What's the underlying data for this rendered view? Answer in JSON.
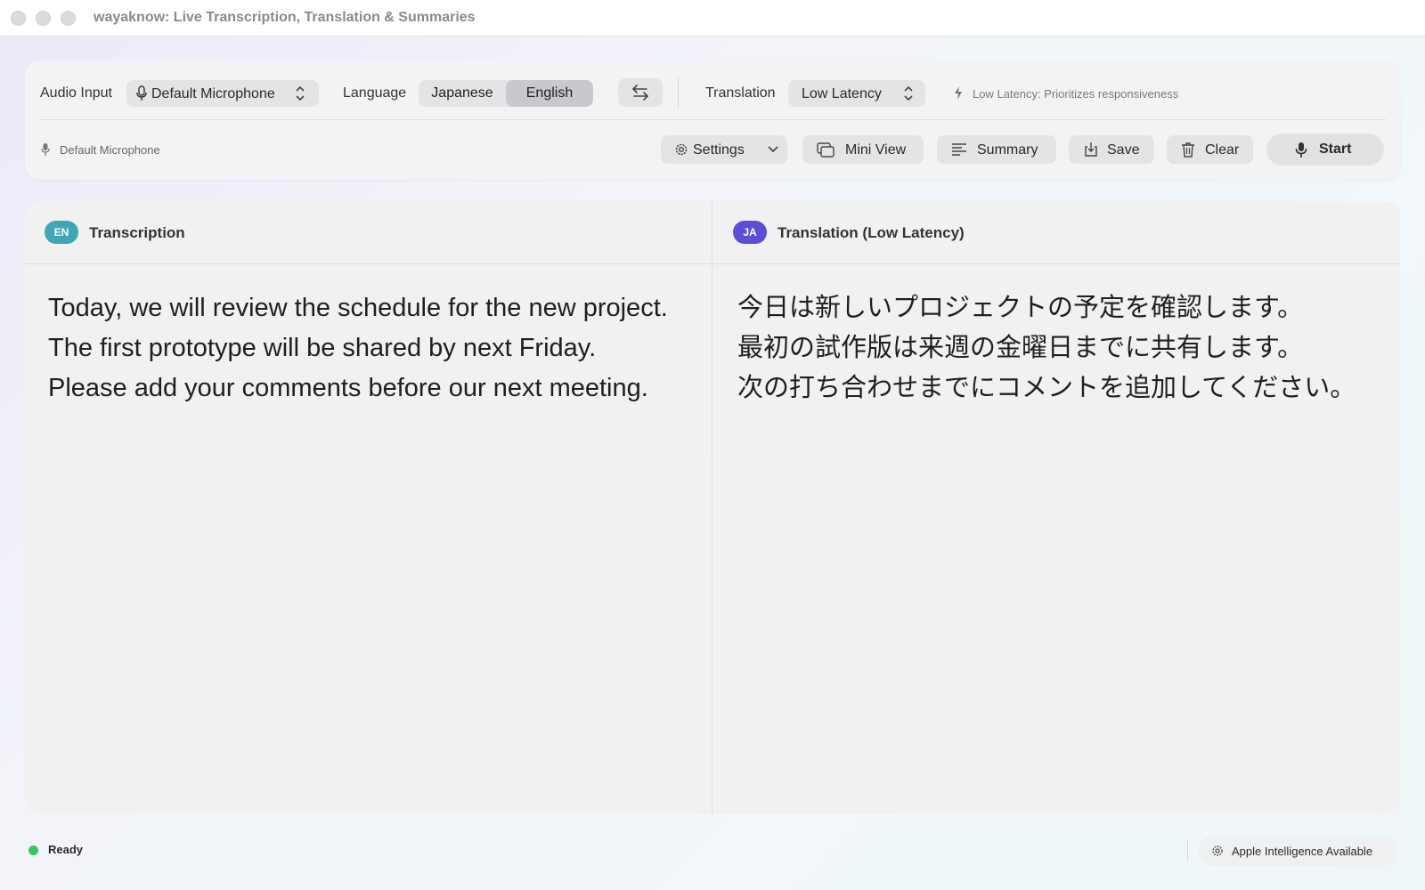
{
  "window": {
    "title": "wayaknow: Live Transcription, Translation & Summaries"
  },
  "toolbar": {
    "audio_input_label": "Audio Input",
    "audio_input_value": "Default Microphone",
    "language_label": "Language",
    "language_options": [
      "Japanese",
      "English"
    ],
    "language_selected": "English",
    "translation_label": "Translation",
    "translation_value": "Low Latency",
    "translation_hint": "Low Latency: Prioritizes responsiveness",
    "mic_status": "Default Microphone",
    "buttons": {
      "settings": "Settings",
      "mini_view": "Mini View",
      "summary": "Summary",
      "save": "Save",
      "clear": "Clear",
      "start": "Start"
    }
  },
  "transcription": {
    "badge": "EN",
    "badge_color": "#3fa7b6",
    "title": "Transcription",
    "lines": [
      "Today, we will review the schedule for the new project.",
      "The first prototype will be shared by next Friday.",
      "Please add your comments before our next meeting."
    ]
  },
  "translation": {
    "badge": "JA",
    "badge_color": "#5a4fd6",
    "title": "Translation (Low Latency)",
    "lines": [
      "今日は新しいプロジェクトの予定を確認します。",
      "最初の試作版は来週の金曜日までに共有します。",
      "次の打ち合わせまでにコメントを追加してください。"
    ]
  },
  "status": {
    "state": "Ready",
    "state_color": "#34c759",
    "ai_status": "Apple Intelligence Available"
  },
  "icons": [
    "microphone-icon",
    "up-down-chevron-icon",
    "swap-arrows-icon",
    "lightning-icon",
    "gear-icon",
    "chevron-down-icon",
    "mini-view-icon",
    "summary-lines-icon",
    "save-icon",
    "trash-icon",
    "sparkle-icon"
  ]
}
